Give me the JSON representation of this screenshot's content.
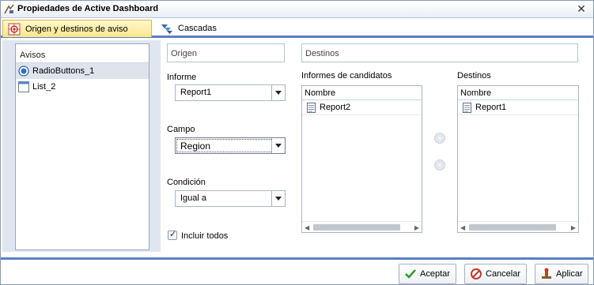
{
  "window": {
    "title": "Propiedades de Active Dashboard"
  },
  "tabs": [
    {
      "label": "Origen y destinos de aviso",
      "icon": "source-target-icon"
    },
    {
      "label": "Cascadas",
      "icon": "cascade-icon"
    }
  ],
  "prompts": {
    "header": "Avisos",
    "items": [
      {
        "label": "RadioButtons_1",
        "icon": "radio-button-icon",
        "selected": true
      },
      {
        "label": "List_2",
        "icon": "list-icon",
        "selected": false
      }
    ]
  },
  "origin": {
    "header": "Origen",
    "report_label": "Informe",
    "report_value": "Report1",
    "field_label": "Campo",
    "field_value": "Region",
    "condition_label": "Condición",
    "condition_value": "Igual a",
    "include_all_label": "Incluir todos",
    "include_all_checked": true
  },
  "targets": {
    "header": "Destinos",
    "candidates_label": "Informes de candidatos",
    "candidates_column": "Nombre",
    "candidates": [
      "Report2"
    ],
    "targets_label": "Destinos",
    "targets_column": "Nombre",
    "targets": [
      "Report1"
    ]
  },
  "footer": {
    "accept": "Aceptar",
    "cancel": "Cancelar",
    "apply": "Aplicar"
  },
  "colors": {
    "accent": "#5b7fc2",
    "tab_active": "#fde68a",
    "panel_bg": "#dfe6f0"
  }
}
